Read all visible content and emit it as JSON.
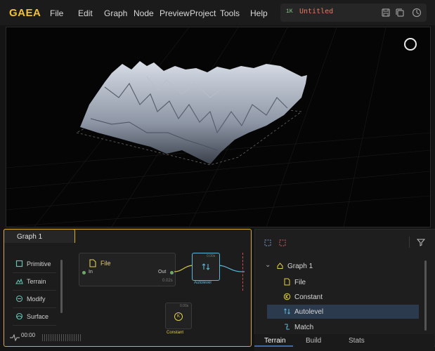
{
  "app": {
    "logo": "GAEA"
  },
  "menu": {
    "items": [
      "File",
      "Edit",
      "Graph",
      "Node",
      "Preview",
      "Project",
      "Tools",
      "Help"
    ]
  },
  "titlebar": {
    "resolution": "1K",
    "document_title": "Untitled",
    "icons": [
      "save-icon",
      "copy-icon",
      "timer-icon"
    ]
  },
  "viewport": {
    "status": "loading"
  },
  "graph": {
    "tab_label": "Graph 1",
    "palette": [
      "Primitive",
      "Terrain",
      "Modify",
      "Surface"
    ],
    "nodes": {
      "file": {
        "title": "File",
        "input": "In",
        "output": "Out",
        "time": "0.02s"
      },
      "autolevel": {
        "label": "Autolevel",
        "time": "0.00s"
      },
      "constant": {
        "label": "Constant",
        "time": "0.00s",
        "glyph": "K"
      }
    },
    "status": {
      "time": "00:00"
    }
  },
  "properties": {
    "tree_root": "Graph 1",
    "tree_items": [
      "File",
      "Constant",
      "Autolevel",
      "Match"
    ],
    "selected_item": "Autolevel"
  },
  "bottom_tabs": {
    "items": [
      "Terrain",
      "Build",
      "Stats"
    ],
    "active": "Terrain"
  }
}
